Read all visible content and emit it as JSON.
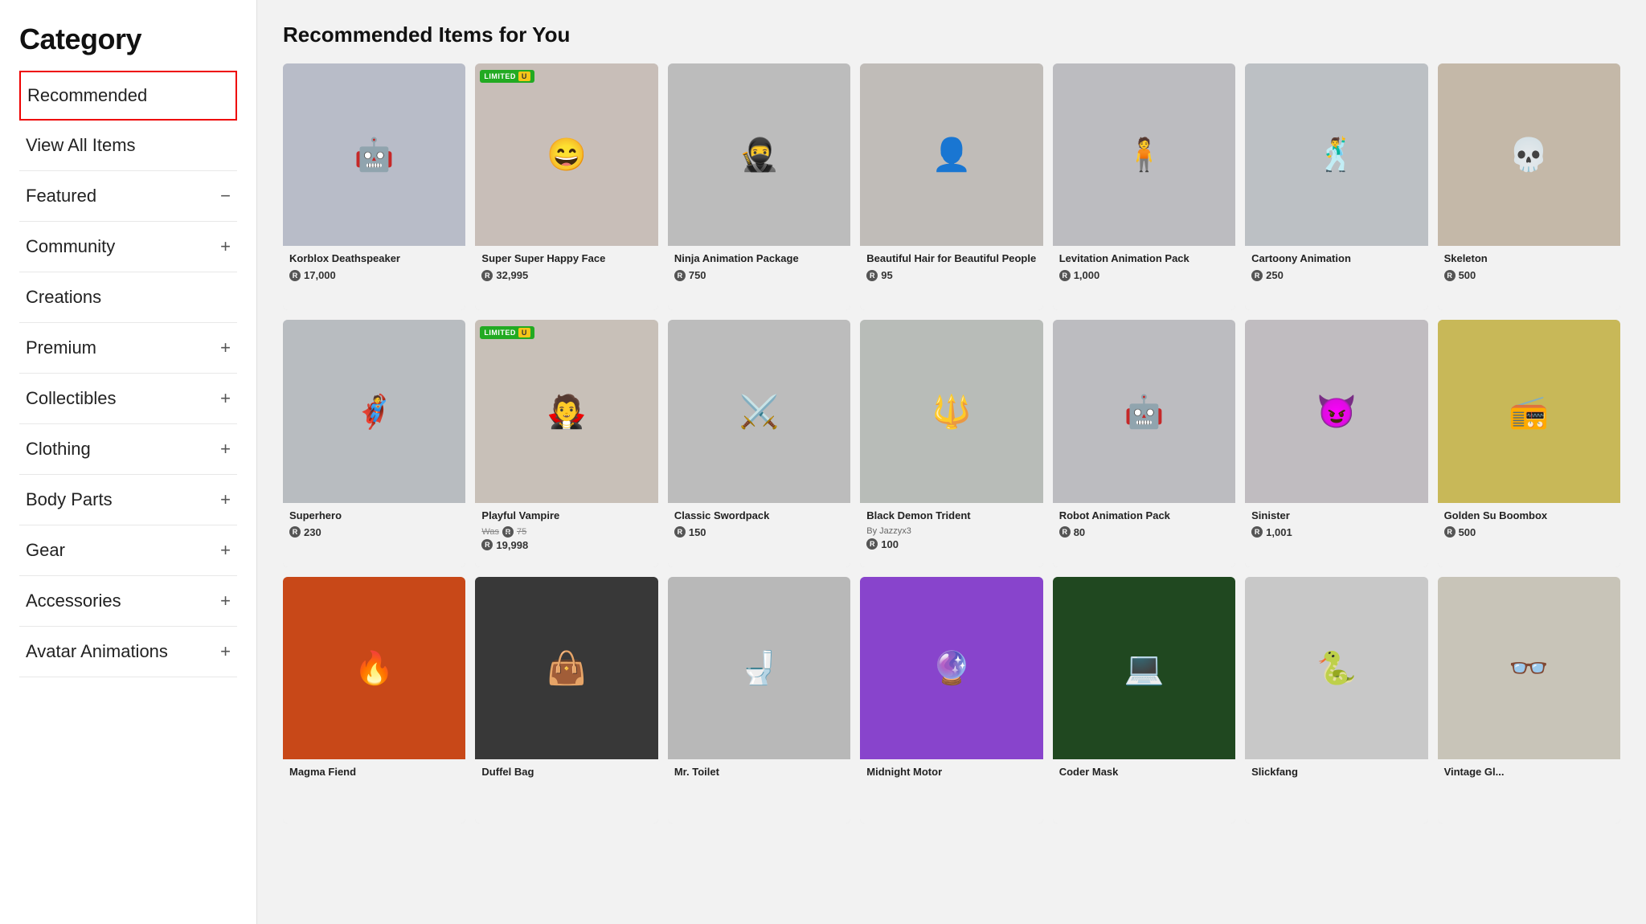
{
  "sidebar": {
    "title": "Category",
    "items": [
      {
        "label": "Recommended",
        "icon": null,
        "active": true
      },
      {
        "label": "View All Items",
        "icon": null,
        "active": false
      },
      {
        "label": "Featured",
        "icon": "−",
        "active": false
      },
      {
        "label": "Community",
        "icon": "+",
        "active": false
      },
      {
        "label": "Creations",
        "icon": null,
        "active": false
      },
      {
        "label": "Premium",
        "icon": "+",
        "active": false
      },
      {
        "label": "Collectibles",
        "icon": "+",
        "active": false
      },
      {
        "label": "Clothing",
        "icon": "+",
        "active": false
      },
      {
        "label": "Body Parts",
        "icon": "+",
        "active": false
      },
      {
        "label": "Gear",
        "icon": "+",
        "active": false
      },
      {
        "label": "Accessories",
        "icon": "+",
        "active": false
      },
      {
        "label": "Avatar Animations",
        "icon": "+",
        "active": false
      }
    ]
  },
  "main": {
    "title": "Recommended Items for You",
    "rows": [
      {
        "items": [
          {
            "name": "Korblox Deathspeaker",
            "price": "17,000",
            "badge": null,
            "emoji": "🤖",
            "bg": "#b8bcc8"
          },
          {
            "name": "Super Super Happy Face",
            "price": "32,995",
            "badge": "LIMITED",
            "badgeU": true,
            "emoji": "😄",
            "bg": "#c8beb8"
          },
          {
            "name": "Ninja Animation Package",
            "price": "750",
            "badge": null,
            "emoji": "🥷",
            "bg": "#bcbcbc"
          },
          {
            "name": "Beautiful Hair for Beautiful People",
            "price": "95",
            "badge": null,
            "emoji": "👤",
            "bg": "#c0bcb8"
          },
          {
            "name": "Levitation Animation Pack",
            "price": "1,000",
            "badge": null,
            "emoji": "🧍",
            "bg": "#bcbcc0"
          },
          {
            "name": "Cartoony Animation",
            "price": "250",
            "badge": null,
            "emoji": "🕺",
            "bg": "#bcc0c4"
          },
          {
            "name": "Skeleton",
            "price": "500",
            "badge": null,
            "emoji": "💀",
            "bg": "#c4b8a8",
            "partial": true
          }
        ]
      },
      {
        "items": [
          {
            "name": "Superhero",
            "price": "230",
            "badge": null,
            "emoji": "🦸",
            "bg": "#b8bcc0"
          },
          {
            "name": "Playful Vampire",
            "price": "19,998",
            "priceOld": "75",
            "badge": "LIMITED",
            "badgeU": true,
            "emoji": "🧛",
            "bg": "#c8c0b8"
          },
          {
            "name": "Classic Swordpack",
            "price": "150",
            "badge": null,
            "emoji": "⚔️",
            "bg": "#bcbcbc"
          },
          {
            "name": "Black Demon Trident",
            "price": "100",
            "creator": "By Jazzyx3",
            "badge": null,
            "emoji": "🔱",
            "bg": "#b8bcb8"
          },
          {
            "name": "Robot Animation Pack",
            "price": "80",
            "badge": null,
            "emoji": "🤖",
            "bg": "#bcbcc0"
          },
          {
            "name": "Sinister",
            "price": "1,001",
            "badge": null,
            "emoji": "😈",
            "bg": "#c0bcc0"
          },
          {
            "name": "Golden Su Boombox",
            "price": "500",
            "badge": null,
            "emoji": "📻",
            "bg": "#c8b858",
            "partial": true
          }
        ]
      },
      {
        "items": [
          {
            "name": "Magma Fiend",
            "price": "",
            "badge": null,
            "emoji": "🔥",
            "bg": "#c84818"
          },
          {
            "name": "Duffel Bag",
            "price": "",
            "badge": null,
            "emoji": "👜",
            "bg": "#383838"
          },
          {
            "name": "Mr. Toilet",
            "price": "",
            "badge": null,
            "emoji": "🚽",
            "bg": "#b8b8b8"
          },
          {
            "name": "Midnight Motor",
            "price": "",
            "badge": null,
            "emoji": "🔮",
            "bg": "#8844cc"
          },
          {
            "name": "Coder Mask",
            "price": "",
            "badge": null,
            "emoji": "💻",
            "bg": "#204820"
          },
          {
            "name": "Slickfang",
            "price": "",
            "badge": null,
            "emoji": "🐍",
            "bg": "#c8c8c8"
          },
          {
            "name": "Vintage Gl...",
            "price": "",
            "badge": null,
            "emoji": "👓",
            "bg": "#c8c4b8",
            "partial": true
          }
        ]
      }
    ]
  },
  "colors": {
    "accent_red": "#cc0000",
    "badge_green": "#22aa22",
    "badge_yellow": "#f5c518"
  },
  "icons": {
    "plus": "+",
    "minus": "−",
    "robux": "R"
  }
}
